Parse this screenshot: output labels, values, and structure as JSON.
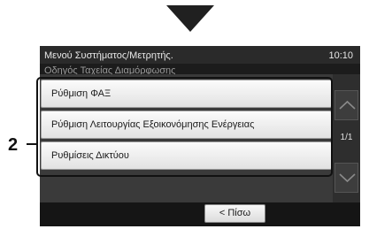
{
  "header": {
    "path": "Μενού Συστήματος/Μετρητής.",
    "time": "10:10",
    "subtitle": "Οδηγός Ταχείας Διαμόρφωσης"
  },
  "menu": {
    "items": [
      {
        "label": "Ρύθμιση ΦΑΞ"
      },
      {
        "label": "Ρύθμιση Λειτουργίας Εξοικονόμησης Ενέργειας"
      },
      {
        "label": "Ρυθμίσεις Δικτύου"
      }
    ]
  },
  "pagination": {
    "indicator": "1/1"
  },
  "footer": {
    "back_label": "< Πίσω"
  },
  "callout": {
    "number": "2"
  },
  "icons": {
    "scroll_up": "chevron-up-icon",
    "scroll_down": "chevron-down-icon",
    "step_arrow": "arrow-down-icon"
  }
}
